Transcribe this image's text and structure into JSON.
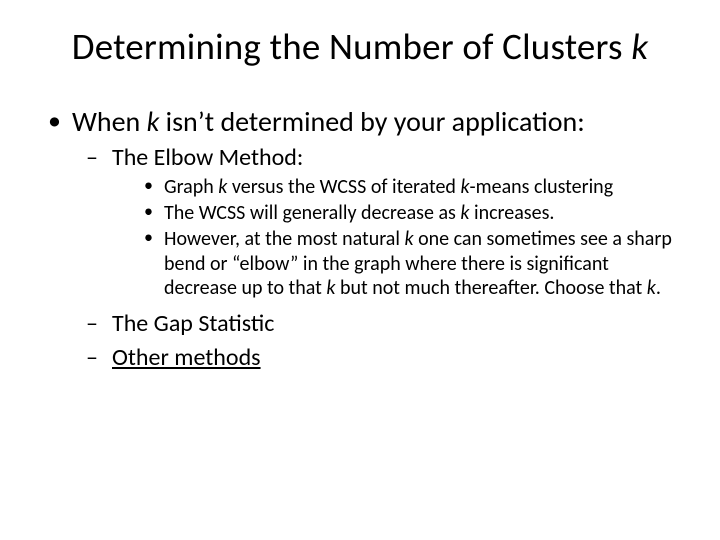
{
  "title_a": "Determining the Number of Clusters ",
  "title_k": "k",
  "lvl1_a": "When ",
  "lvl1_k": "k",
  "lvl1_b": " isn’t determined by your application:",
  "elbow_label": "The Elbow Method:",
  "elbow_1a": "Graph ",
  "elbow_1k1": "k",
  "elbow_1b": " versus the WCSS of iterated ",
  "elbow_1k2": "k",
  "elbow_1c": "-means clustering",
  "elbow_2a": "The WCSS will generally decrease as ",
  "elbow_2k": "k",
  "elbow_2b": " increases.",
  "elbow_3a": "However, at the most natural ",
  "elbow_3k1": "k",
  "elbow_3b": " one can sometimes see a sharp bend or “elbow” in the graph where there is significant decrease up to that ",
  "elbow_3k2": "k",
  "elbow_3c": " but not much thereafter.  Choose that ",
  "elbow_3k3": "k",
  "elbow_3d": ".",
  "gap_label": "The Gap Statistic",
  "other_label": "Other methods"
}
